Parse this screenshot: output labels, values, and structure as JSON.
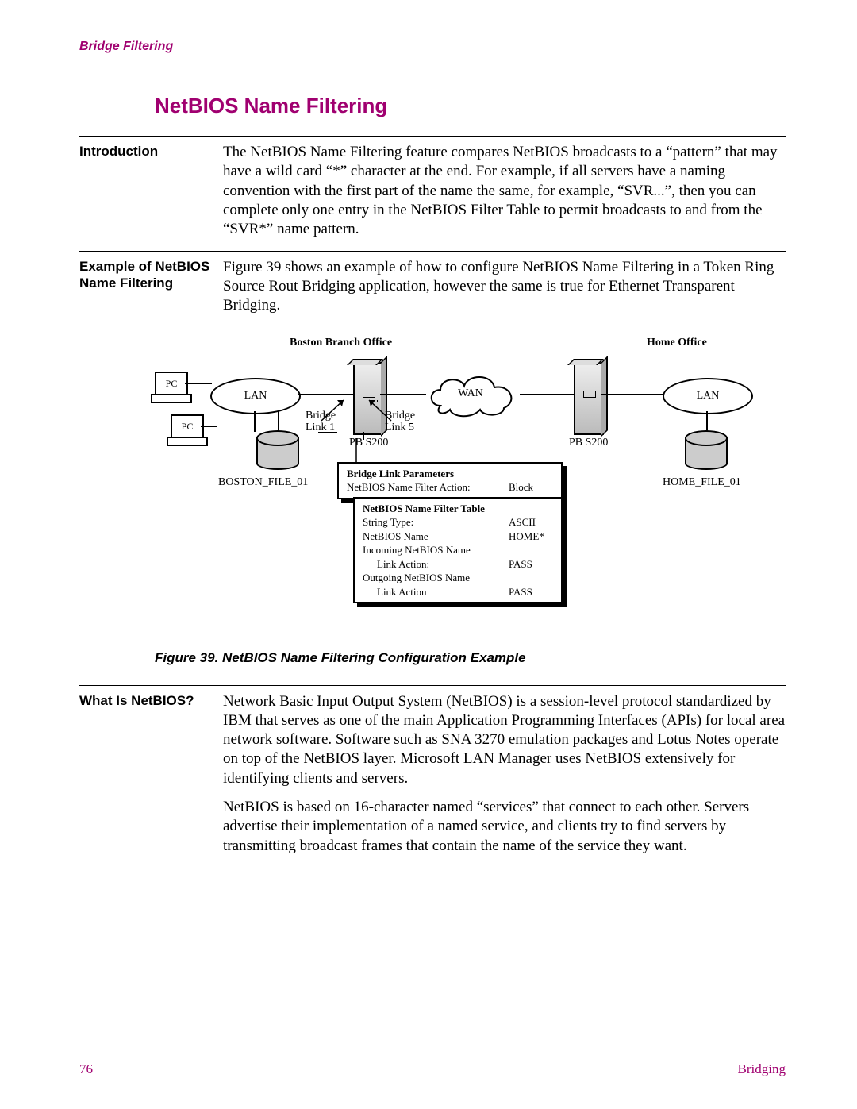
{
  "running_head": "Bridge Filtering",
  "title": "NetBIOS Name Filtering",
  "intro": {
    "label": "Introduction",
    "text": "The NetBIOS Name Filtering feature compares NetBIOS broadcasts to a “pattern” that may have a wild card “*” character at the end. For example, if all servers have a naming convention with the first part of the name the same, for example, “SVR...”, then you can complete only one entry in the NetBIOS Filter Table to permit broadcasts to and from the “SVR*” name pattern."
  },
  "example": {
    "label": "Example of NetBIOS Name Filtering",
    "text": "Figure 39 shows an example of how to configure NetBIOS Name Filtering in a Token Ring Source Rout Bridging application, however the same is true for Ethernet Transparent Bridging."
  },
  "figure": {
    "caption": "Figure 39. NetBIOS Name Filtering Configuration Example",
    "boston_label": "Boston Branch Office",
    "home_label": "Home Office",
    "pc": "PC",
    "lan": "LAN",
    "wan": "WAN",
    "bridge_link1": "Bridge Link 1",
    "bridge_link5": "Bridge Link 5",
    "pb_s200": "PB S200",
    "boston_file": "BOSTON_FILE_01",
    "home_file": "HOME_FILE_01",
    "box1_title": "Bridge Link Parameters",
    "box1_k": "NetBIOS Name Filter Action:",
    "box1_v": "Block",
    "box2_title": "NetBIOS Name Filter Table",
    "box2_r1k": "String Type:",
    "box2_r1v": "ASCII",
    "box2_r2k": "NetBIOS Name",
    "box2_r2v": "HOME*",
    "box2_r3k": "Incoming NetBIOS Name",
    "box2_r3ak": "Link Action:",
    "box2_r3av": "PASS",
    "box2_r4k": "Outgoing NetBIOS Name",
    "box2_r4ak": "Link Action",
    "box2_r4av": "PASS"
  },
  "what": {
    "label": "What Is NetBIOS?",
    "p1": "Network Basic Input Output System (NetBIOS) is a session-level protocol standardized by IBM that serves as one of the main Application Programming Interfaces (APIs) for local area network software. Software such as SNA 3270 emulation packages and Lotus Notes operate on top of the NetBIOS layer. Microsoft LAN Manager uses NetBIOS extensively for identifying clients and servers.",
    "p2": "NetBIOS is based on 16-character named “services” that connect to each other. Servers advertise their implementation of a named service, and clients try to find servers by transmitting broadcast frames that contain the name of the service they want."
  },
  "footer": {
    "page": "76",
    "chapter": "Bridging"
  }
}
